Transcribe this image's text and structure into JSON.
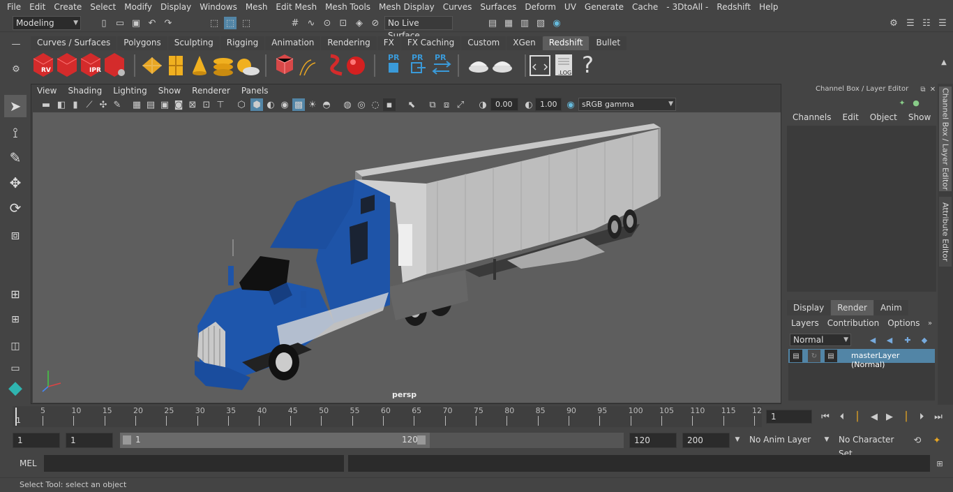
{
  "menubar": [
    "File",
    "Edit",
    "Create",
    "Select",
    "Modify",
    "Display",
    "Windows",
    "Mesh",
    "Edit Mesh",
    "Mesh Tools",
    "Mesh Display",
    "Curves",
    "Surfaces",
    "Deform",
    "UV",
    "Generate",
    "Cache",
    "- 3DtoAll -",
    "Redshift",
    "Help"
  ],
  "status": {
    "workspace": "Modeling",
    "live_surface": "No Live Surface"
  },
  "shelf_tabs": [
    "Curves / Surfaces",
    "Polygons",
    "Sculpting",
    "Rigging",
    "Animation",
    "Rendering",
    "FX",
    "FX Caching",
    "Custom",
    "XGen",
    "Redshift",
    "Bullet"
  ],
  "shelf_active": "Redshift",
  "shelf_labels": {
    "rv": "RV",
    "ipr": "IPR",
    "pr": "PR",
    "log": ".LOG",
    "help": "?"
  },
  "viewport_menus": [
    "View",
    "Shading",
    "Lighting",
    "Show",
    "Renderer",
    "Panels"
  ],
  "viewport_toolbar": {
    "exposure": "0.00",
    "gamma": "1.00",
    "colorspace": "sRGB gamma"
  },
  "viewport_label": "persp",
  "channel_box": {
    "title": "Channel Box / Layer Editor",
    "menus": [
      "Channels",
      "Edit",
      "Object",
      "Show"
    ],
    "layer_tabs": [
      "Display",
      "Render",
      "Anim"
    ],
    "layer_tab_active": "Render",
    "layer_menus": [
      "Layers",
      "Contribution",
      "Options"
    ],
    "blend_mode": "Normal",
    "layer_name": "masterLayer (Normal)"
  },
  "side_tabs": [
    "Channel Box / Layer Editor",
    "Attribute Editor"
  ],
  "timeline": {
    "ticks": [
      "5",
      "10",
      "15",
      "20",
      "25",
      "30",
      "35",
      "40",
      "45",
      "50",
      "55",
      "60",
      "65",
      "70",
      "75",
      "80",
      "85",
      "90",
      "95",
      "100",
      "105",
      "110",
      "115",
      "12"
    ],
    "start_marker": "1",
    "current_frame": "1"
  },
  "range": {
    "start": "1",
    "playback_start": "1",
    "slider_start": "1",
    "slider_end": "120",
    "playback_end": "120",
    "end": "200",
    "anim_layer": "No Anim Layer",
    "character_set": "No Character Set"
  },
  "mel": {
    "label": "MEL"
  },
  "help_line": "Select Tool: select an object",
  "colors": {
    "accent": "#5285a6",
    "truck_blue": "#1e54a8"
  }
}
